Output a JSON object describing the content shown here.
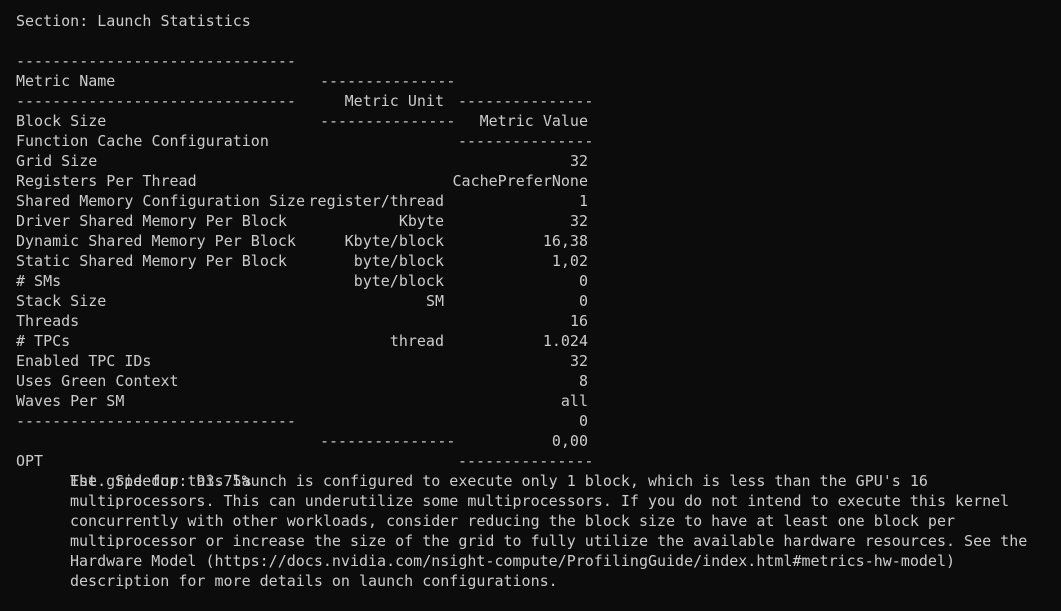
{
  "section_title": "Section: Launch Statistics",
  "separator": {
    "name": "-------------------------------",
    "unit": "---------------",
    "value": "---------------"
  },
  "headers": {
    "name": "Metric Name",
    "unit": "Metric Unit",
    "value": "Metric Value"
  },
  "metrics": [
    {
      "name": "Block Size",
      "unit": "",
      "value": "32"
    },
    {
      "name": "Function Cache Configuration",
      "unit": "",
      "value": "CachePreferNone"
    },
    {
      "name": "Grid Size",
      "unit": "",
      "value": "1"
    },
    {
      "name": "Registers Per Thread",
      "unit": "register/thread",
      "value": "32"
    },
    {
      "name": "Shared Memory Configuration Size",
      "unit": "Kbyte",
      "value": "16,38"
    },
    {
      "name": "Driver Shared Memory Per Block",
      "unit": "Kbyte/block",
      "value": "1,02"
    },
    {
      "name": "Dynamic Shared Memory Per Block",
      "unit": "byte/block",
      "value": "0"
    },
    {
      "name": "Static Shared Memory Per Block",
      "unit": "byte/block",
      "value": "0"
    },
    {
      "name": "# SMs",
      "unit": "SM",
      "value": "16"
    },
    {
      "name": "Stack Size",
      "unit": "",
      "value": "1.024"
    },
    {
      "name": "Threads",
      "unit": "thread",
      "value": "32"
    },
    {
      "name": "# TPCs",
      "unit": "",
      "value": "8"
    },
    {
      "name": "Enabled TPC IDs",
      "unit": "",
      "value": "all"
    },
    {
      "name": "Uses Green Context",
      "unit": "",
      "value": "0"
    },
    {
      "name": "Waves Per SM",
      "unit": "",
      "value": "0,00"
    }
  ],
  "opt": {
    "label": "OPT",
    "speedup": "Est. Speedup: 93.75%",
    "lines": [
      "The grid for this launch is configured to execute only 1 block, which is less than the GPU's 16",
      "multiprocessors. This can underutilize some multiprocessors. If you do not intend to execute this kernel",
      "concurrently with other workloads, consider reducing the block size to have at least one block per",
      "multiprocessor or increase the size of the grid to fully utilize the available hardware resources. See the",
      "Hardware Model (https://docs.nvidia.com/nsight-compute/ProfilingGuide/index.html#metrics-hw-model)",
      "description for more details on launch configurations."
    ]
  },
  "colors": {
    "background": "#0c0c0c",
    "foreground": "#cccccc"
  }
}
